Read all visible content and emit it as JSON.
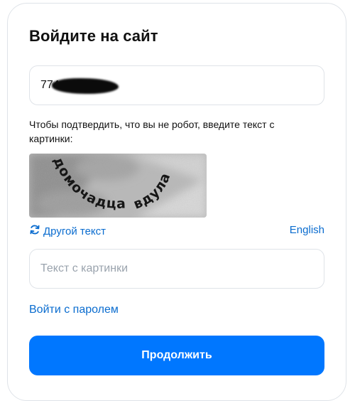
{
  "form": {
    "title": "Войдите на сайт",
    "login_value": "774",
    "hint": "Чтобы подтвердить, что вы не робот, введите текст с картинки:",
    "captcha": {
      "word_1": "домочадца",
      "word_2": "вдула"
    },
    "refresh_label": "Другой текст",
    "language_label": "English",
    "captcha_placeholder": "Текст с картинки",
    "password_link": "Войти с паролем",
    "continue_label": "Продолжить"
  },
  "colors": {
    "accent": "#0077ff",
    "link": "#0a6ccf",
    "border": "#dfe3e8"
  },
  "icons": {
    "refresh": "refresh-icon"
  }
}
